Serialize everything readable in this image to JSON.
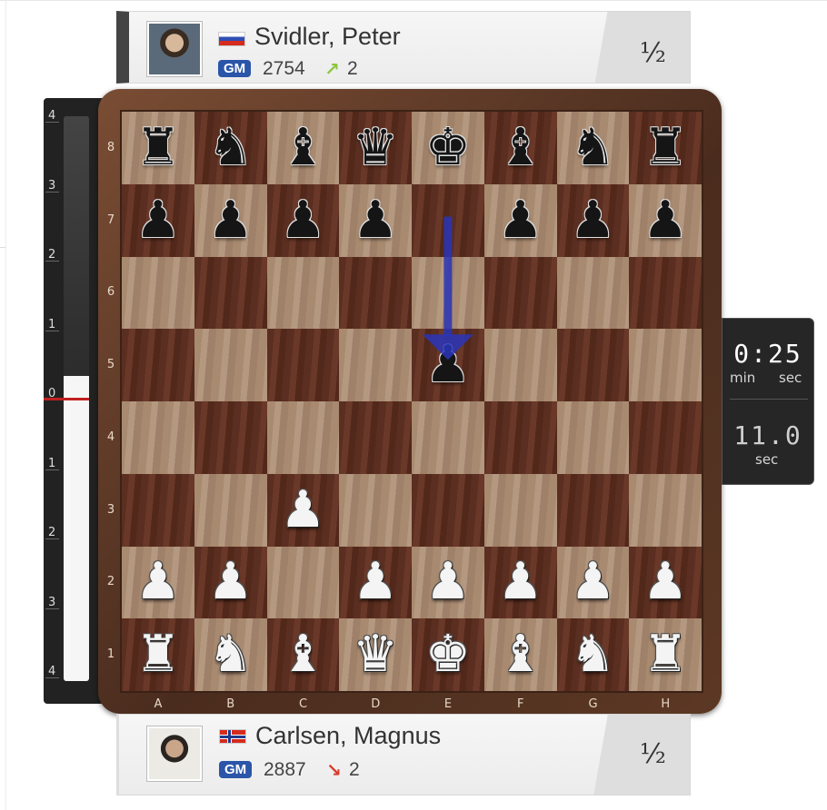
{
  "top_player": {
    "name": "Svidler, Peter",
    "title": "GM",
    "rating": "2754",
    "delta": "2",
    "delta_direction": "up",
    "flag": "russia-flag",
    "score": "½"
  },
  "bottom_player": {
    "name": "Carlsen, Magnus",
    "title": "GM",
    "rating": "2887",
    "delta": "2",
    "delta_direction": "down",
    "flag": "norway-flag",
    "score": "½"
  },
  "clock": {
    "main": "0:25",
    "main_unit_1": "min",
    "main_unit_2": "sec",
    "increment": "11.0",
    "increment_unit": "sec"
  },
  "eval_bar": {
    "labels": [
      "4",
      "3",
      "2",
      "1",
      "0",
      "1",
      "2",
      "3",
      "4"
    ],
    "white_share": 0.54
  },
  "board": {
    "files": [
      "A",
      "B",
      "C",
      "D",
      "E",
      "F",
      "G",
      "H"
    ],
    "ranks": [
      "8",
      "7",
      "6",
      "5",
      "4",
      "3",
      "2",
      "1"
    ],
    "pieces": [
      {
        "sq": "a8",
        "p": "♜",
        "c": "black",
        "n": "black-rook"
      },
      {
        "sq": "b8",
        "p": "♞",
        "c": "black",
        "n": "black-knight"
      },
      {
        "sq": "c8",
        "p": "♝",
        "c": "black",
        "n": "black-bishop"
      },
      {
        "sq": "d8",
        "p": "♛",
        "c": "black",
        "n": "black-queen"
      },
      {
        "sq": "e8",
        "p": "♚",
        "c": "black",
        "n": "black-king"
      },
      {
        "sq": "f8",
        "p": "♝",
        "c": "black",
        "n": "black-bishop"
      },
      {
        "sq": "g8",
        "p": "♞",
        "c": "black",
        "n": "black-knight"
      },
      {
        "sq": "h8",
        "p": "♜",
        "c": "black",
        "n": "black-rook"
      },
      {
        "sq": "a7",
        "p": "♟",
        "c": "black",
        "n": "black-pawn"
      },
      {
        "sq": "b7",
        "p": "♟",
        "c": "black",
        "n": "black-pawn"
      },
      {
        "sq": "c7",
        "p": "♟",
        "c": "black",
        "n": "black-pawn"
      },
      {
        "sq": "d7",
        "p": "♟",
        "c": "black",
        "n": "black-pawn"
      },
      {
        "sq": "f7",
        "p": "♟",
        "c": "black",
        "n": "black-pawn"
      },
      {
        "sq": "g7",
        "p": "♟",
        "c": "black",
        "n": "black-pawn"
      },
      {
        "sq": "h7",
        "p": "♟",
        "c": "black",
        "n": "black-pawn"
      },
      {
        "sq": "e5",
        "p": "♟",
        "c": "black",
        "n": "black-pawn"
      },
      {
        "sq": "c3",
        "p": "♟",
        "c": "white",
        "n": "white-pawn"
      },
      {
        "sq": "a2",
        "p": "♟",
        "c": "white",
        "n": "white-pawn"
      },
      {
        "sq": "b2",
        "p": "♟",
        "c": "white",
        "n": "white-pawn"
      },
      {
        "sq": "d2",
        "p": "♟",
        "c": "white",
        "n": "white-pawn"
      },
      {
        "sq": "e2",
        "p": "♟",
        "c": "white",
        "n": "white-pawn"
      },
      {
        "sq": "f2",
        "p": "♟",
        "c": "white",
        "n": "white-pawn"
      },
      {
        "sq": "g2",
        "p": "♟",
        "c": "white",
        "n": "white-pawn"
      },
      {
        "sq": "h2",
        "p": "♟",
        "c": "white",
        "n": "white-pawn"
      },
      {
        "sq": "a1",
        "p": "♜",
        "c": "white",
        "n": "white-rook"
      },
      {
        "sq": "b1",
        "p": "♞",
        "c": "white",
        "n": "white-knight"
      },
      {
        "sq": "c1",
        "p": "♝",
        "c": "white",
        "n": "white-bishop"
      },
      {
        "sq": "d1",
        "p": "♛",
        "c": "white",
        "n": "white-queen"
      },
      {
        "sq": "e1",
        "p": "♚",
        "c": "white",
        "n": "white-king"
      },
      {
        "sq": "f1",
        "p": "♝",
        "c": "white",
        "n": "white-bishop"
      },
      {
        "sq": "g1",
        "p": "♞",
        "c": "white",
        "n": "white-knight"
      },
      {
        "sq": "h1",
        "p": "♜",
        "c": "white",
        "n": "white-rook"
      }
    ],
    "last_move": {
      "from": "e7",
      "to": "e5"
    }
  },
  "colors": {
    "arrow": "#2a35b8",
    "eval_zero": "#c02020",
    "gm_badge": "#2a55a8",
    "delta_up": "#8cc63f",
    "delta_down": "#d93b2b"
  }
}
